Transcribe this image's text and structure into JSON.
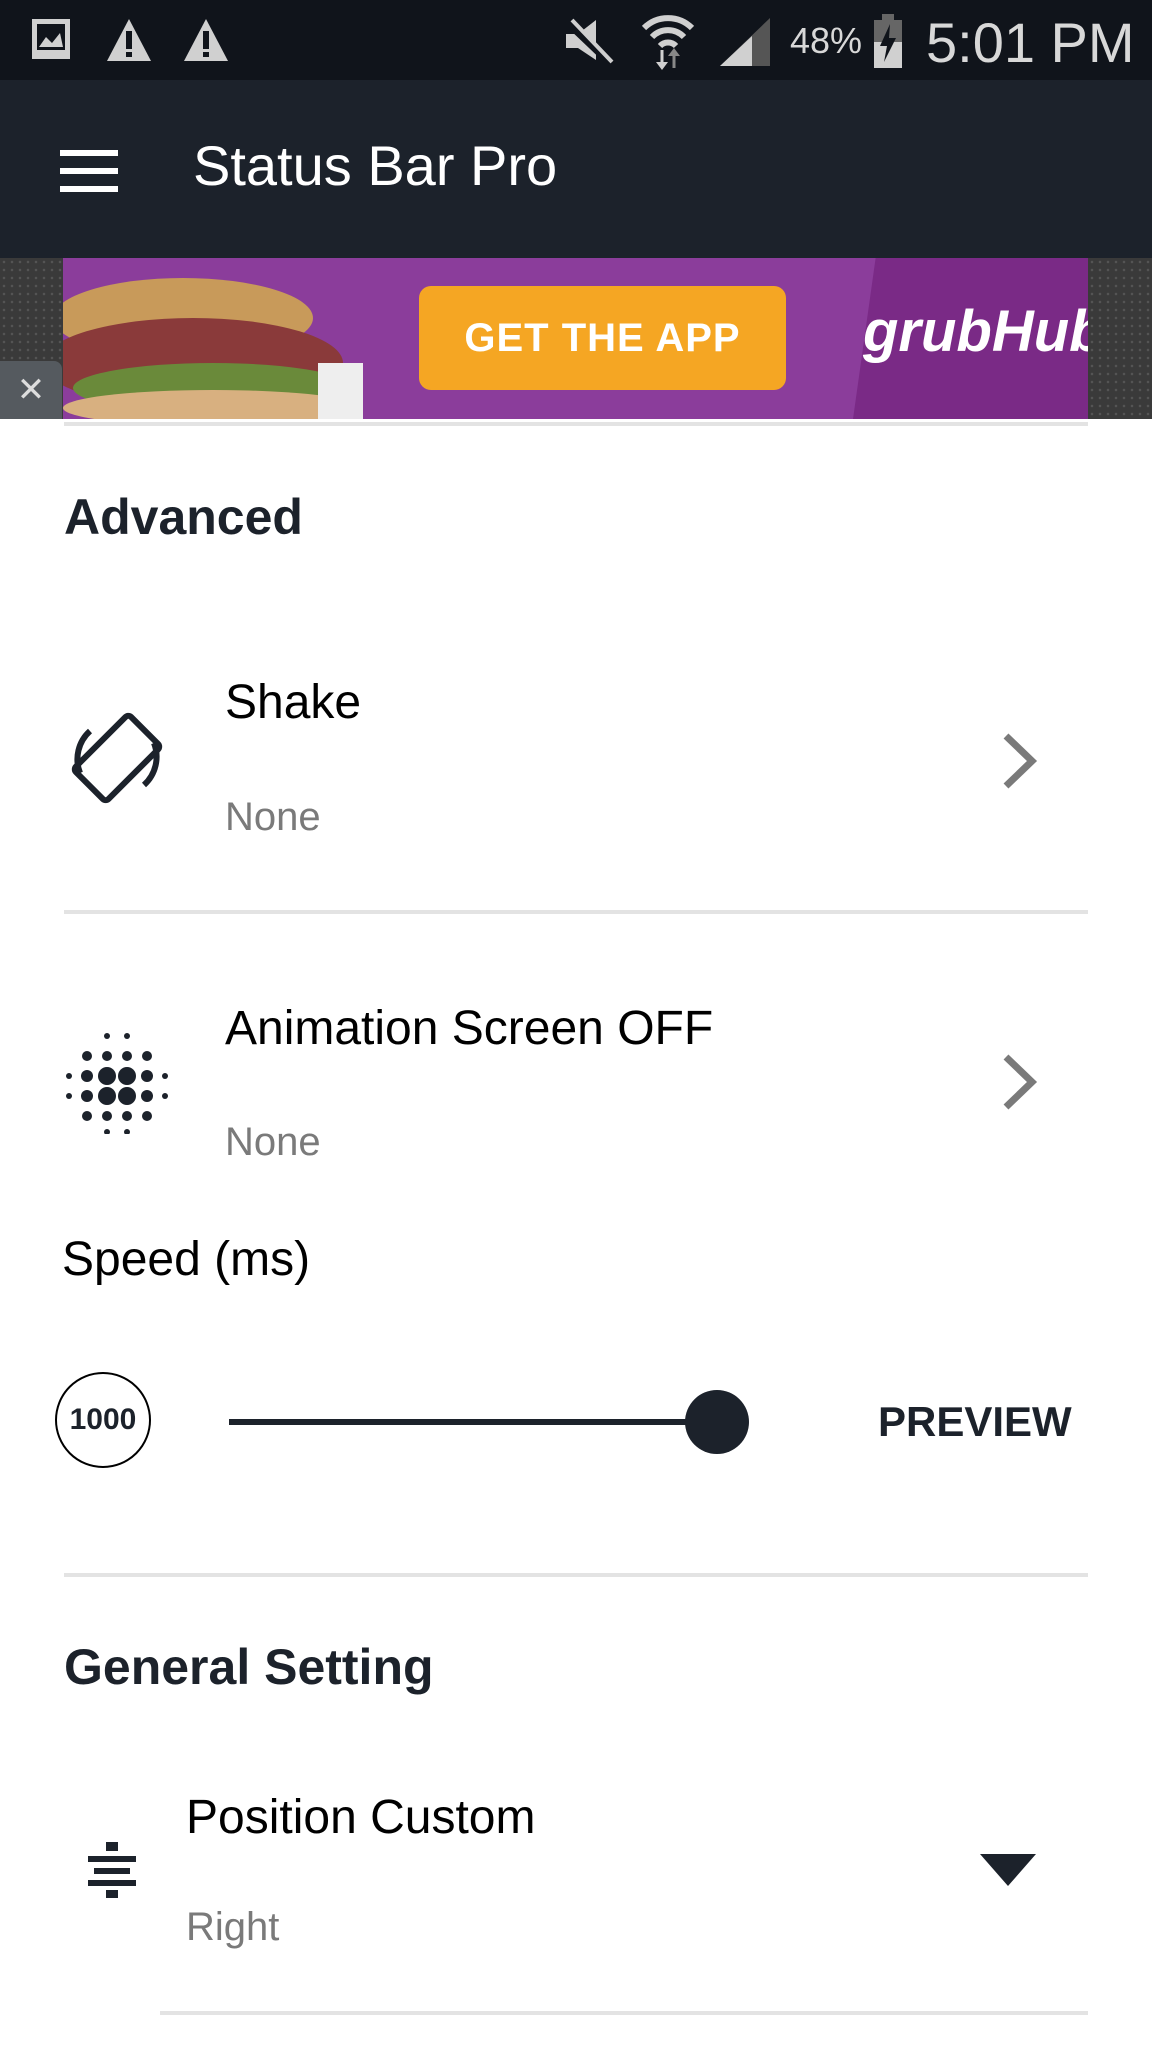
{
  "status_bar": {
    "left_icons": [
      "gallery-icon",
      "warning-icon",
      "warning-icon"
    ],
    "right_icons": [
      "mute-icon",
      "wifi-icon",
      "signal-icon",
      "battery-charging-icon"
    ],
    "battery": "48%",
    "time": "5:01 PM"
  },
  "app_bar": {
    "menu_icon": "hamburger-icon",
    "title": "Status Bar Pro"
  },
  "ad": {
    "cta": "GET THE APP",
    "brand": "grubHub",
    "close": "✕",
    "colors": {
      "background": "#8b3d9b",
      "cta": "#f5a623"
    }
  },
  "sections": {
    "advanced": {
      "title": "Advanced",
      "items": [
        {
          "icon": "screen-rotation-icon",
          "title": "Shake",
          "value": "None"
        },
        {
          "icon": "dots-pattern-icon",
          "title": "Animation Screen OFF",
          "value": "None"
        }
      ],
      "speed": {
        "label": "Speed (ms)",
        "value": "1000",
        "slider_fraction": 1.0,
        "preview_label": "PREVIEW"
      }
    },
    "general": {
      "title": "General Setting",
      "items": [
        {
          "icon": "align-center-icon",
          "title": "Position Custom",
          "value": "Right"
        }
      ]
    }
  },
  "colors": {
    "app_bar": "#1c222b",
    "status_bar": "#10141b",
    "accent": "#1c222b",
    "subtitle": "#7a7a7a"
  }
}
